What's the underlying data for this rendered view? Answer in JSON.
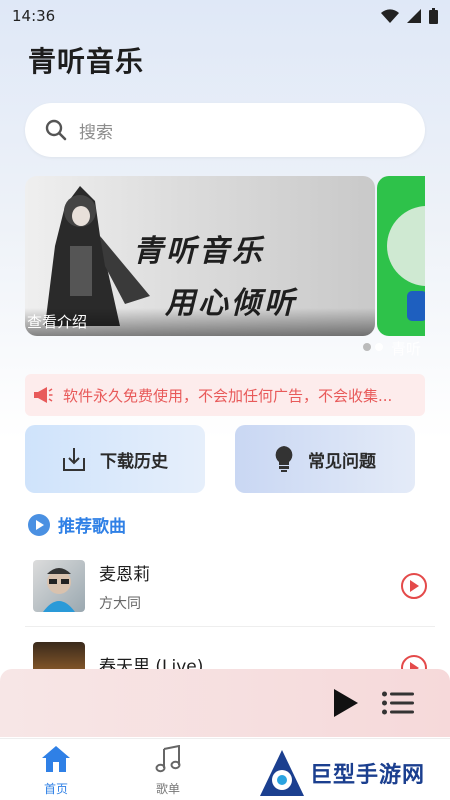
{
  "status_bar": {
    "time": "14:36"
  },
  "app": {
    "title": "青听音乐"
  },
  "search": {
    "placeholder": "搜索"
  },
  "banner": {
    "line1": "青听音乐",
    "line2": "用心倾听",
    "caption": "查看介绍",
    "next_caption": "青听"
  },
  "notice": {
    "text": "软件永久免费使用，不会加任何广告，不会收集..."
  },
  "quick_actions": {
    "download_history": "下载历史",
    "faq": "常见问题"
  },
  "section": {
    "title": "推荐歌曲"
  },
  "songs": [
    {
      "title": "麦恩莉",
      "artist": "方大同"
    },
    {
      "title": "春天里 (Live)",
      "artist": ""
    }
  ],
  "tabs": {
    "home": "首页",
    "playlist": "歌单"
  },
  "watermark": {
    "text": "巨型手游网"
  },
  "colors": {
    "accent": "#2f80e6",
    "notice": "#e85a5a",
    "play": "#e44a4a"
  }
}
